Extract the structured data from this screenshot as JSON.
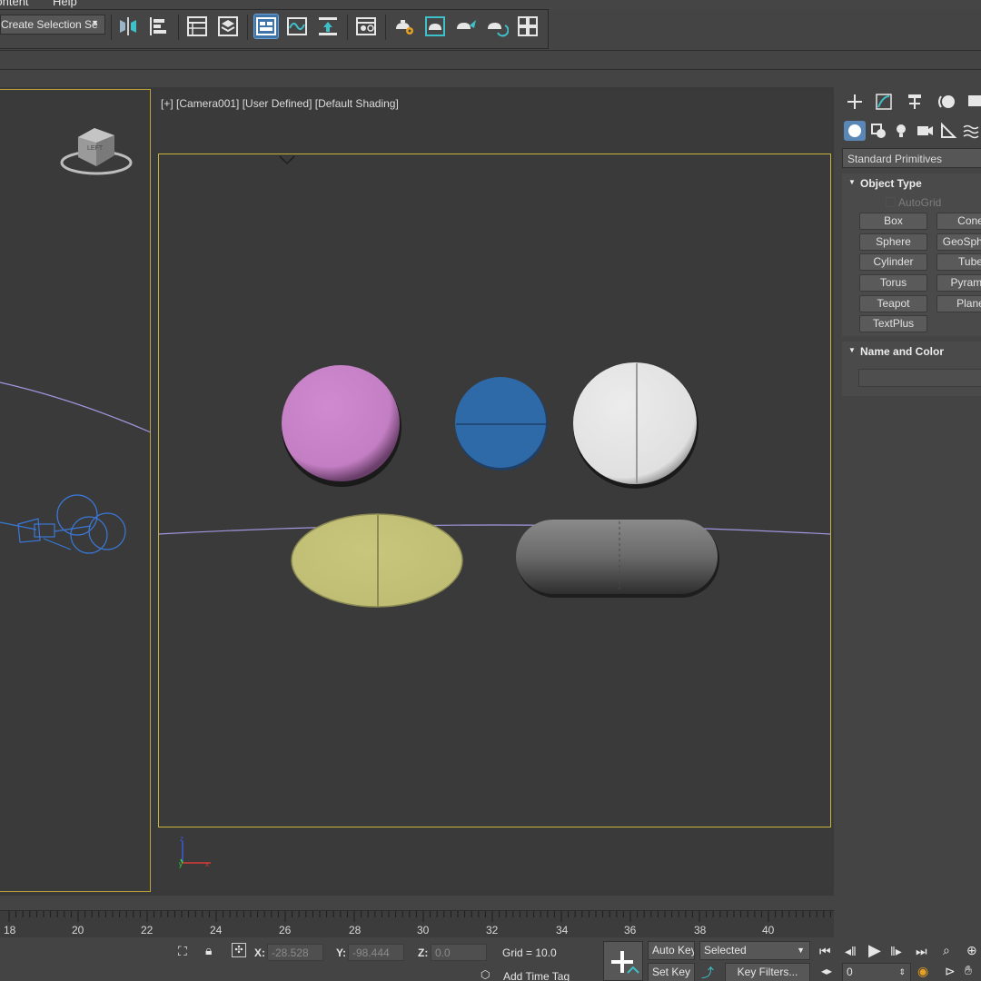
{
  "menu": {
    "items": [
      "Content",
      "Help"
    ]
  },
  "toolbar": {
    "selection_set": "Create Selection Se",
    "icons": [
      "mirror-icon",
      "align-icon",
      "scene-explorer-icon",
      "layer-explorer-icon",
      "ribbon-toggle-icon",
      "curve-editor-icon",
      "schematic-view-icon",
      "material-editor-icon",
      "render-setup-icon",
      "rendered-frame-window-icon",
      "render-icon",
      "render-iterative-icon",
      "render-cloud-icon",
      "render-gallery-icon"
    ]
  },
  "viewport": {
    "label": "[+] [Camera001] [User Defined] [Default Shading]",
    "axis": {
      "z": "z",
      "x": "x",
      "y": "y"
    },
    "viewcube_label": "LEFT"
  },
  "objects": [
    {
      "name": "pink-round-pill",
      "color": "#c47fc4"
    },
    {
      "name": "blue-scored-pill",
      "color": "#2f6aa8"
    },
    {
      "name": "white-scored-pill",
      "color": "#e6e6e6"
    },
    {
      "name": "yellow-oval-pill",
      "color": "#c2c277"
    },
    {
      "name": "gray-capsule",
      "color": "#6c6c6c"
    }
  ],
  "command_panel": {
    "category": "Standard Primitives",
    "object_type": {
      "title": "Object Type",
      "autogrid": "AutoGrid",
      "buttons": [
        "Box",
        "Cone",
        "Sphere",
        "GeoSphere",
        "Cylinder",
        "Tube",
        "Torus",
        "Pyramid",
        "Teapot",
        "Plane",
        "TextPlus"
      ]
    },
    "name_and_color": {
      "title": "Name and Color",
      "name": ""
    }
  },
  "timeline": {
    "ticks": [
      "18",
      "20",
      "22",
      "24",
      "26",
      "28",
      "30",
      "32",
      "34",
      "36",
      "38",
      "40"
    ]
  },
  "status": {
    "x_label": "X:",
    "x_value": "-28.528",
    "y_label": "Y:",
    "y_value": "-98.444",
    "z_label": "Z:",
    "z_value": "0.0",
    "grid": "Grid = 10.0",
    "add_time_tag": "Add Time Tag",
    "auto_key": "Auto Key",
    "selected": "Selected",
    "set_key": "Set Key",
    "key_filters": "Key Filters...",
    "frame": "0"
  },
  "colors": {
    "accent": "#3e74a8",
    "safe_frame": "#c8b43a",
    "trajectory": "#a098e0"
  }
}
